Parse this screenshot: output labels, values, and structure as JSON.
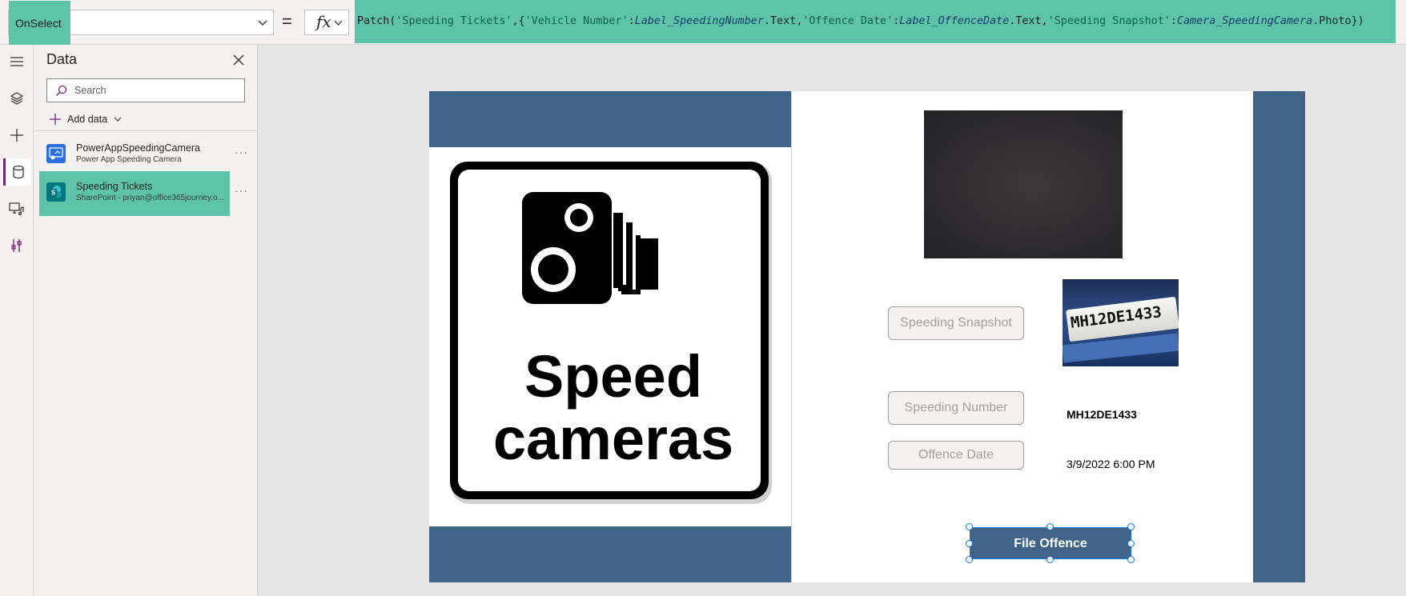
{
  "formula_bar": {
    "property": "OnSelect",
    "equals": "=",
    "fx_label": "fx",
    "formula_tokens": [
      {
        "t": "fn",
        "v": "Patch("
      },
      {
        "t": "str",
        "v": "'Speeding Tickets'"
      },
      {
        "t": "plain",
        "v": ",{"
      },
      {
        "t": "str",
        "v": "'Vehicle Number'"
      },
      {
        "t": "plain",
        "v": ":"
      },
      {
        "t": "ref",
        "v": "Label_SpeedingNumber"
      },
      {
        "t": "plain",
        "v": ".Text,"
      },
      {
        "t": "str",
        "v": "'Offence Date'"
      },
      {
        "t": "plain",
        "v": ":"
      },
      {
        "t": "ref",
        "v": "Label_OffenceDate"
      },
      {
        "t": "plain",
        "v": ".Text,"
      },
      {
        "t": "str",
        "v": "'Speeding Snapshot'"
      },
      {
        "t": "plain",
        "v": ":"
      },
      {
        "t": "ref",
        "v": "Camera_SpeedingCamera"
      },
      {
        "t": "plain",
        "v": ".Photo})"
      }
    ]
  },
  "left_rail": {
    "items": [
      {
        "name": "hamburger-icon",
        "active": false
      },
      {
        "name": "layers-icon",
        "active": false
      },
      {
        "name": "plus-icon",
        "active": false
      },
      {
        "name": "database-icon",
        "active": true
      },
      {
        "name": "media-icon",
        "active": false
      },
      {
        "name": "tools-icon",
        "active": false
      }
    ]
  },
  "data_pane": {
    "title": "Data",
    "search_placeholder": "Search",
    "add_data_label": "Add data",
    "sources": [
      {
        "name": "PowerAppSpeedingCamera",
        "subtitle": "Power App Speeding Camera",
        "icon": "power-apps-icon",
        "icon_color": "#2a6fe0",
        "selected": false
      },
      {
        "name": "Speeding Tickets",
        "subtitle": "SharePoint - priyan@office365journey.o...",
        "icon": "sharepoint-icon",
        "icon_color": "#03787c",
        "selected": true
      }
    ]
  },
  "app": {
    "sign_line_1": "Speed",
    "sign_line_2": "cameras",
    "label_snapshot": "Speeding Snapshot",
    "label_number": "Speeding Number",
    "label_date": "Offence Date",
    "plate_text": "MH12DE1433",
    "vehicle_number": "MH12DE1433",
    "offence_date": "3/9/2022 6:00 PM",
    "file_button_label": "File Offence"
  },
  "colors": {
    "selection_teal": "#5ec4a9",
    "app_blue": "#3f6488",
    "selection_handle": "#1a73e8"
  }
}
